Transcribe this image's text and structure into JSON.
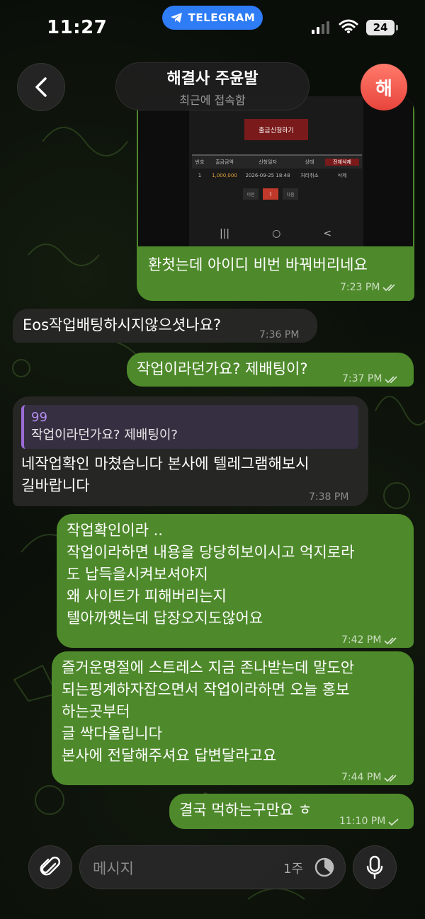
{
  "status": {
    "time": "11:27",
    "app_pill": "TELEGRAM",
    "battery": "24"
  },
  "header": {
    "title": "해결사 주윤발",
    "subtitle": "최근에 접속함",
    "avatar_letter": "해"
  },
  "media_message": {
    "screenshot": {
      "button": "출금신청하기",
      "columns": [
        "번호",
        "출금금액",
        "신청일자",
        "상태",
        "전체삭제"
      ],
      "row": [
        "1",
        "1,000,000",
        "2026-09-25 18:48",
        "처리취소",
        "삭제"
      ],
      "pager": [
        "이전",
        "1",
        "다음"
      ],
      "nav": [
        "|||",
        "○",
        "<"
      ]
    },
    "caption": "환첫는데 아이디 비번 바꿔버리네요",
    "time": "7:23 PM"
  },
  "messages": [
    {
      "dir": "in",
      "text": "Eos작업배팅하시지않으셧나요?",
      "time": "7:36 PM"
    },
    {
      "dir": "out",
      "text": "작업이라던가요? 제배팅이?",
      "time": "7:37 PM"
    },
    {
      "dir": "in",
      "reply_name": "99",
      "reply_text": "작업이라던가요? 제배팅이?",
      "text": "네작업확인 마쳤습니다 본사에 텔레그램해보시\n길바랍니다",
      "time": "7:38 PM"
    },
    {
      "dir": "out",
      "text": "작업확인이라 ..\n작업이라하면 내용을 당당히보이시고 억지로라\n도 납득을시켜보셔야지\n왜 사이트가 피해버리는지\n텔아까햇는데 답장오지도않어요",
      "time": "7:42 PM"
    },
    {
      "dir": "out",
      "text": "즐거운명절에 스트레스 지금 존나받는데 말도안\n되는핑계하자잡으면서 작업이라하면 오늘 홍보\n하는곳부터\n글 싹다올립니다\n본사에 전달해주셔요 답변달라고요",
      "time": "7:44 PM"
    },
    {
      "dir": "out",
      "text": "결국 먹하는구만요 ㅎ",
      "time": "11:10 PM"
    }
  ],
  "input": {
    "placeholder": "메시지",
    "timer_label": "1주"
  },
  "colors": {
    "outgoing": "#4e8a2b",
    "incoming": "#262624",
    "telegram_blue": "#2e7cf6",
    "reply_accent": "#9b6bd8"
  },
  "icons": [
    "back-chevron-icon",
    "paperclip-icon",
    "timer-icon",
    "microphone-icon",
    "double-check-icon",
    "single-check-icon",
    "wifi-icon",
    "telegram-plane-icon"
  ]
}
